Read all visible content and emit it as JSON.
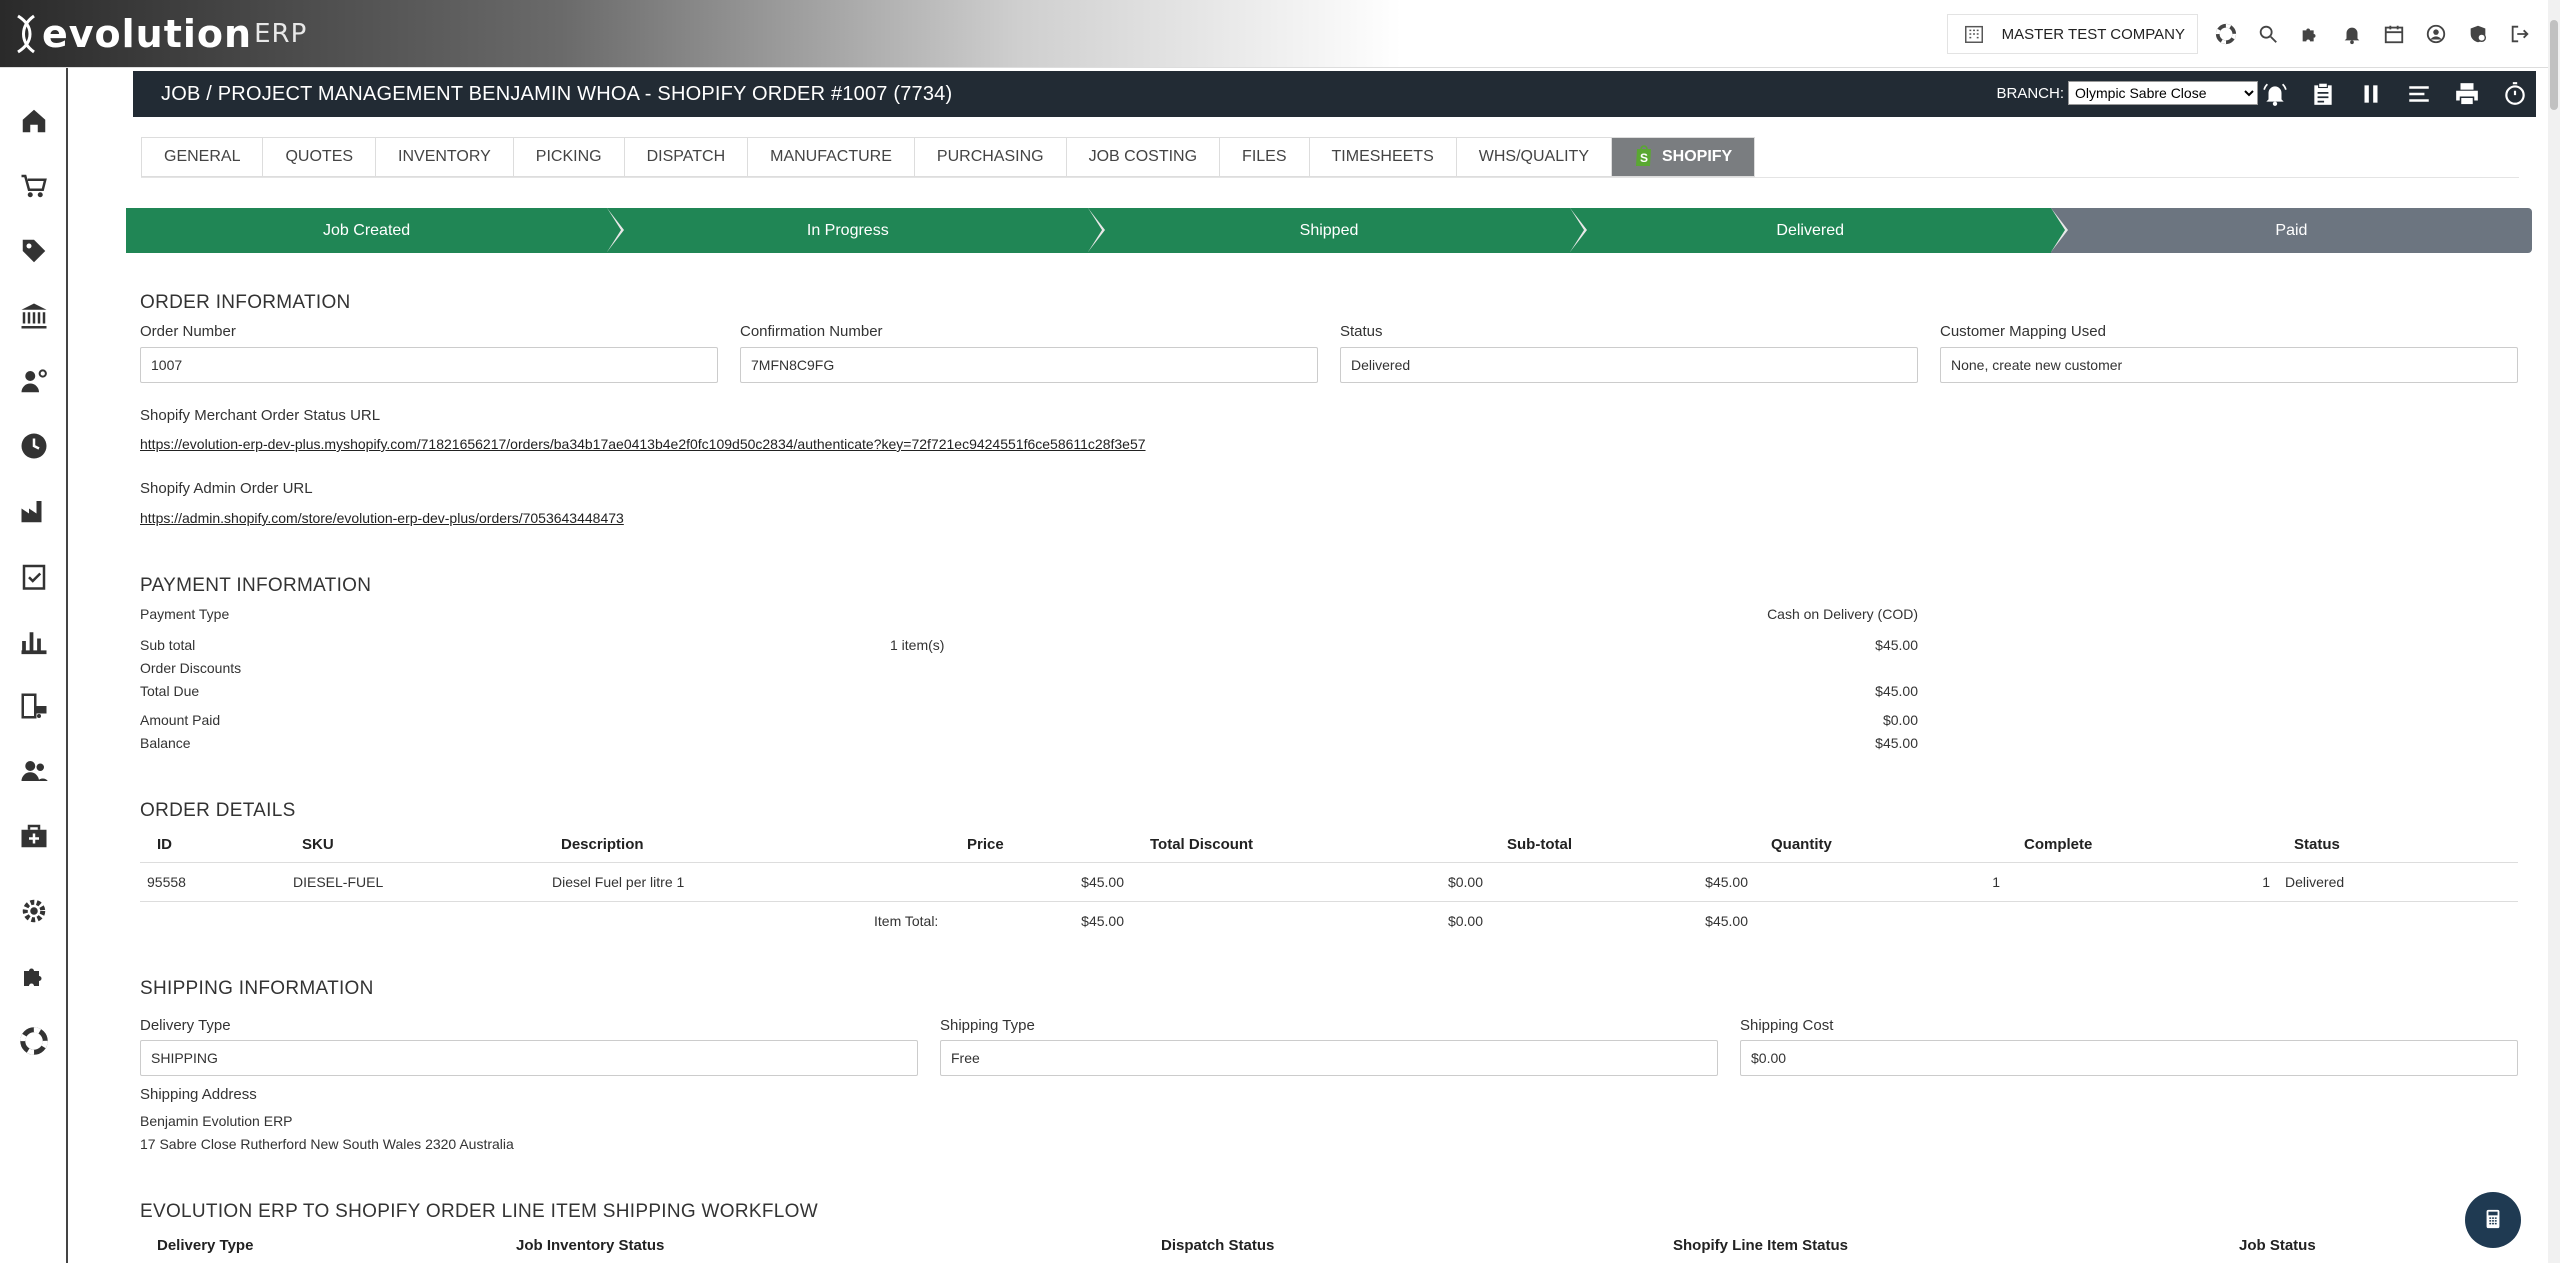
{
  "app": {
    "logo_main": "evolution",
    "logo_suffix": "ERP",
    "company": "MASTER TEST COMPANY"
  },
  "topbar_icons": [
    "building-icon",
    "lifebuoy-icon",
    "search-icon",
    "puzzle-icon",
    "bell-icon",
    "calendar-icon",
    "user-circle-icon",
    "shield-user-icon",
    "logout-icon"
  ],
  "sidebar": {
    "items": [
      "home-icon",
      "cart-icon",
      "tag-icon",
      "bank-icon",
      "user-cog-icon",
      "clock-icon",
      "factory-icon",
      "clipboard-check-icon",
      "bar-chart-icon",
      "building-truck-icon",
      "users-icon",
      "medical-kit-icon",
      "gear-icon",
      "puzzle-icon",
      "lifebuoy-icon"
    ]
  },
  "header": {
    "title": "JOB / PROJECT MANAGEMENT BENJAMIN WHOA - SHOPIFY ORDER #1007 (7734)",
    "branch_label": "BRANCH:",
    "branch_value": "Olympic Sabre Close",
    "icons": [
      "bell-ring-icon",
      "clipboard-icon",
      "pause-icon",
      "menu-lines-icon",
      "printer-icon",
      "stopwatch-icon"
    ]
  },
  "tabs": [
    {
      "label": "GENERAL"
    },
    {
      "label": "QUOTES"
    },
    {
      "label": "INVENTORY"
    },
    {
      "label": "PICKING"
    },
    {
      "label": "DISPATCH"
    },
    {
      "label": "MANUFACTURE"
    },
    {
      "label": "PURCHASING"
    },
    {
      "label": "JOB COSTING"
    },
    {
      "label": "FILES"
    },
    {
      "label": "TIMESHEETS"
    },
    {
      "label": "WHS/QUALITY"
    },
    {
      "label": "SHOPIFY",
      "active": true
    }
  ],
  "progress": [
    {
      "label": "Job Created",
      "done": true
    },
    {
      "label": "In Progress",
      "done": true
    },
    {
      "label": "Shipped",
      "done": true
    },
    {
      "label": "Delivered",
      "done": true
    },
    {
      "label": "Paid",
      "done": false
    }
  ],
  "order_info": {
    "title": "ORDER INFORMATION",
    "order_number_label": "Order Number",
    "order_number": "1007",
    "confirmation_label": "Confirmation Number",
    "confirmation": "7MFN8C9FG",
    "status_label": "Status",
    "status": "Delivered",
    "mapping_label": "Customer Mapping Used",
    "mapping": "None, create new customer",
    "status_url_label": "Shopify Merchant Order Status URL",
    "status_url": "https://evolution-erp-dev-plus.myshopify.com/71821656217/orders/ba34b17ae0413b4e2f0fc109d50c2834/authenticate?key=72f721ec9424551f6ce58611c28f3e57",
    "admin_url_label": "Shopify Admin Order URL",
    "admin_url": "https://admin.shopify.com/store/evolution-erp-dev-plus/orders/7053643448473"
  },
  "payment": {
    "title": "PAYMENT INFORMATION",
    "payment_type_label": "Payment Type",
    "payment_type": "Cash on Delivery (COD)",
    "subtotal_label": "Sub total",
    "items": "1 item(s)",
    "subtotal": "$45.00",
    "discounts_label": "Order Discounts",
    "total_due_label": "Total Due",
    "total_due": "$45.00",
    "amount_paid_label": "Amount Paid",
    "amount_paid": "$0.00",
    "balance_label": "Balance",
    "balance": "$45.00"
  },
  "order_details": {
    "title": "ORDER DETAILS",
    "columns": [
      "ID",
      "SKU",
      "Description",
      "Price",
      "Total Discount",
      "Sub-total",
      "Quantity",
      "Complete",
      "Status"
    ],
    "rows": [
      {
        "id": "95558",
        "sku": "DIESEL-FUEL",
        "description": "Diesel Fuel per litre 1",
        "price": "$45.00",
        "discount": "$0.00",
        "subtotal": "$45.00",
        "quantity": "1",
        "complete": "1",
        "status": "Delivered"
      }
    ],
    "totals_label": "Item Total:",
    "totals_price": "$45.00",
    "totals_discount": "$0.00",
    "totals_subtotal": "$45.00"
  },
  "shipping": {
    "title": "SHIPPING INFORMATION",
    "delivery_type_label": "Delivery Type",
    "delivery_type": "SHIPPING",
    "shipping_type_label": "Shipping Type",
    "shipping_type": "Free",
    "shipping_cost_label": "Shipping Cost",
    "shipping_cost": "$0.00",
    "address_label": "Shipping Address",
    "address_line1": "Benjamin Evolution ERP",
    "address_line2": "17 Sabre Close Rutherford New South Wales 2320 Australia"
  },
  "workflow": {
    "title": "EVOLUTION ERP TO SHOPIFY ORDER LINE ITEM SHIPPING WORKFLOW",
    "columns": [
      "Delivery Type",
      "Job Inventory Status",
      "Dispatch Status",
      "Shopify Line Item Status",
      "Job Status"
    ]
  },
  "fab_icon": "calculator-icon"
}
